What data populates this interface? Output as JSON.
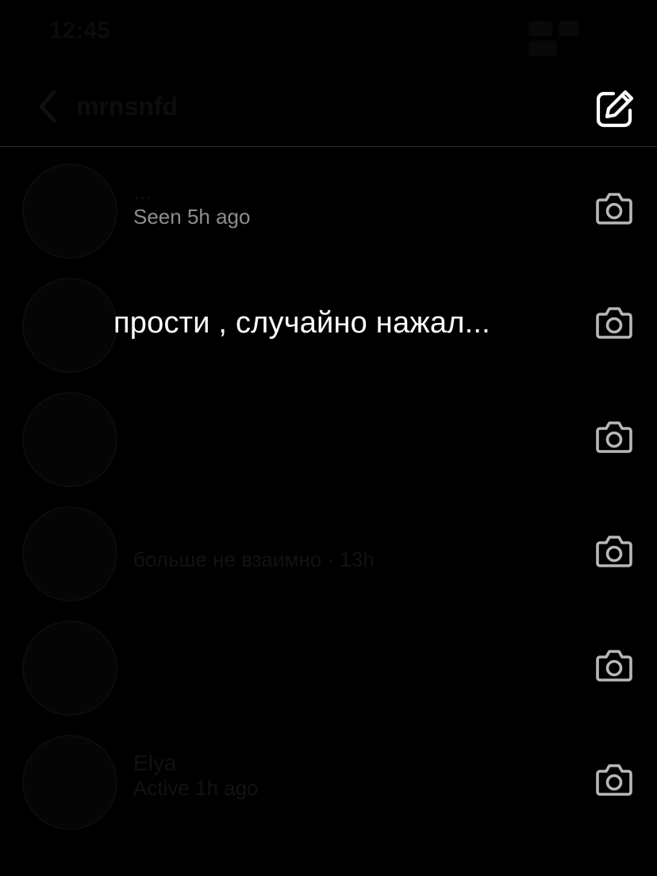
{
  "status_bar": {
    "time": "12:45"
  },
  "header": {
    "title": "mrnsnfd",
    "compose_icon": "compose-icon"
  },
  "overlay_caption": "прости , случайно нажал...",
  "rows": [
    {
      "name": "...",
      "subtitle": "Seen 5h ago",
      "subtitle_visible": true
    },
    {
      "name": "",
      "subtitle": ""
    },
    {
      "name": "",
      "subtitle": ""
    },
    {
      "name": "",
      "subtitle": "больше не взаимно · 13h"
    },
    {
      "name": "",
      "subtitle": ""
    },
    {
      "name": "Elya",
      "subtitle": "Active 1h ago"
    }
  ],
  "colors": {
    "background": "#000000",
    "caption": "#ffffff",
    "secondary_text": "#8e8e8e",
    "icon": "#ffffff",
    "camera_icon": "#b8b8b8"
  }
}
